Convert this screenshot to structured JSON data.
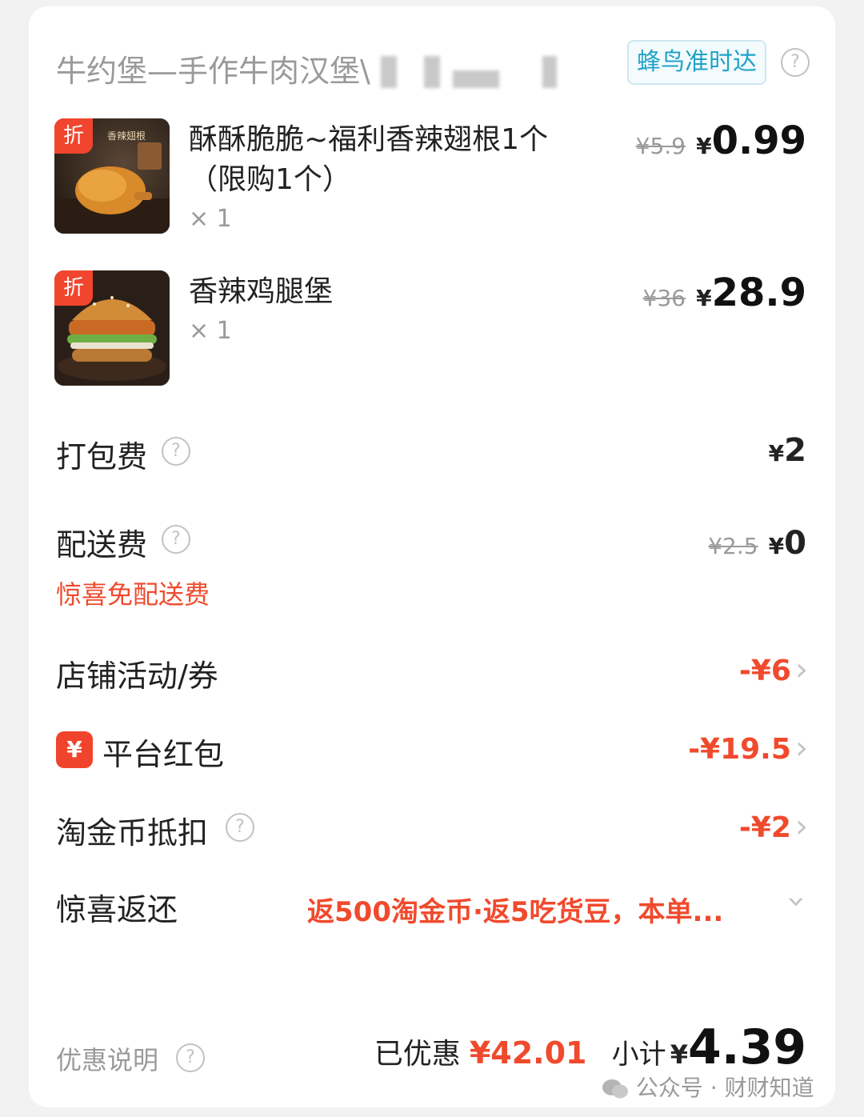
{
  "shop": {
    "name": "牛约堡—手作牛肉汉堡\\",
    "delivery_badge": "蜂鸟准时达",
    "help_glyph": "?"
  },
  "items": [
    {
      "tag": "折",
      "name_line1": "酥酥脆脆~福利香辣翅根1个",
      "name_line2": "（限购1个）",
      "qty": "× 1",
      "original_price": "¥5.9",
      "currency": "¥",
      "price": "0.99",
      "image_label": "香辣翅根"
    },
    {
      "tag": "折",
      "name_line1": "香辣鸡腿堡",
      "qty": "× 1",
      "original_price": "¥36",
      "currency": "¥",
      "price": "28.9"
    }
  ],
  "fees": {
    "packing": {
      "label": "打包费",
      "currency": "¥",
      "value": "2"
    },
    "delivery": {
      "label": "配送费",
      "original": "¥2.5",
      "currency": "¥",
      "value": "0",
      "note": "惊喜免配送费"
    }
  },
  "discounts": [
    {
      "label": "店铺活动/券",
      "value": "-¥6"
    },
    {
      "label": "平台红包",
      "value": "-¥19.5",
      "icon_glyph": "¥"
    },
    {
      "label": "淘金币抵扣",
      "value": "-¥2"
    }
  ],
  "surprise": {
    "label": "惊喜返还",
    "value": "返500淘金币·返5吃货豆，本单..."
  },
  "footer": {
    "explain_label": "优惠说明",
    "saved_label": "已优惠",
    "saved_value": "¥42.01",
    "subtotal_label": "小计",
    "currency": "¥",
    "subtotal_value": "4.39"
  },
  "watermark": {
    "text": "公众号 · 财财知道"
  },
  "colors": {
    "accent_red": "#f04a2d",
    "badge_blue": "#20a3c9"
  }
}
